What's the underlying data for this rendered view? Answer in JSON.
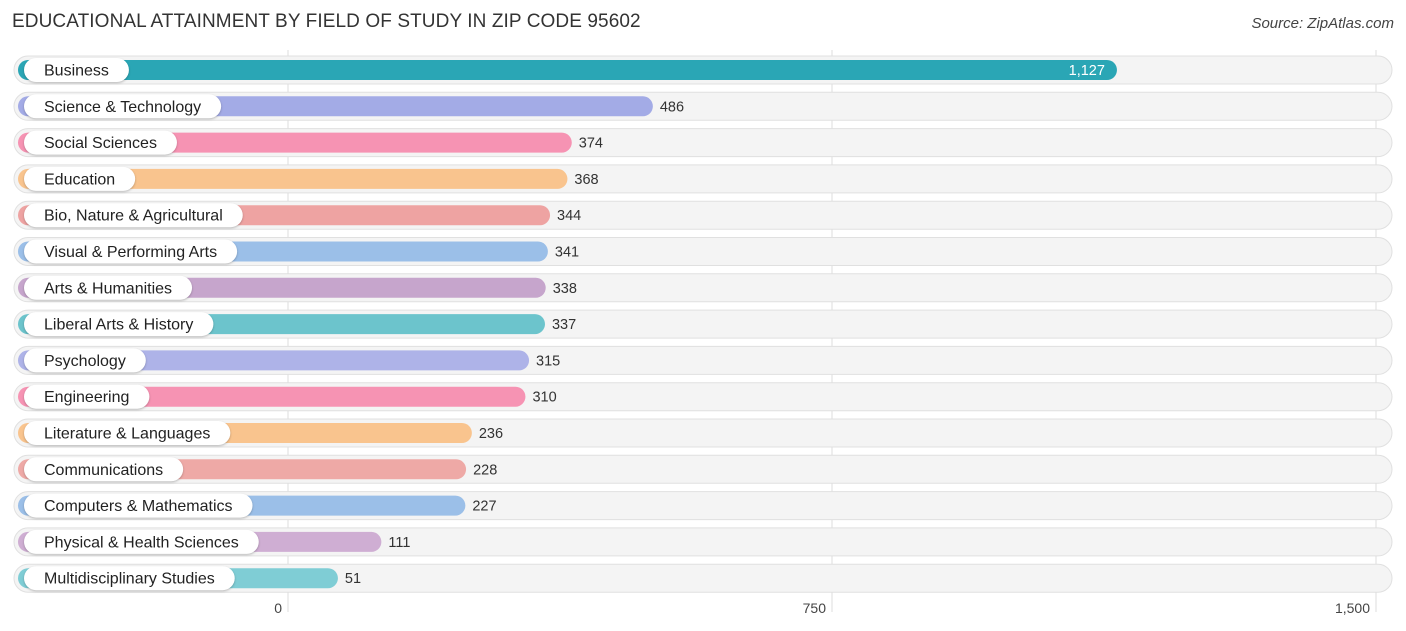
{
  "title": "EDUCATIONAL ATTAINMENT BY FIELD OF STUDY IN ZIP CODE 95602",
  "source": "Source: ZipAtlas.com",
  "chart_data": {
    "type": "bar",
    "orientation": "horizontal",
    "title": "EDUCATIONAL ATTAINMENT BY FIELD OF STUDY IN ZIP CODE 95602",
    "xlabel": "",
    "ylabel": "",
    "xlim": [
      0,
      1500
    ],
    "xticks": [
      0,
      750,
      1500
    ],
    "xtick_labels": [
      "0",
      "750",
      "1,500"
    ],
    "grid": true,
    "categories": [
      "Business",
      "Science & Technology",
      "Social Sciences",
      "Education",
      "Bio, Nature & Agricultural",
      "Visual & Performing Arts",
      "Arts & Humanities",
      "Liberal Arts & History",
      "Psychology",
      "Engineering",
      "Literature & Languages",
      "Communications",
      "Computers & Mathematics",
      "Physical & Health Sciences",
      "Multidisciplinary Studies"
    ],
    "values": [
      1127,
      486,
      374,
      368,
      344,
      341,
      338,
      337,
      315,
      310,
      236,
      228,
      227,
      111,
      51
    ],
    "value_labels": [
      "1,127",
      "486",
      "374",
      "368",
      "344",
      "341",
      "338",
      "337",
      "315",
      "310",
      "236",
      "228",
      "227",
      "111",
      "51"
    ],
    "colors": [
      "#2aa6b5",
      "#a3abe6",
      "#f693b3",
      "#f9c48e",
      "#eea3a2",
      "#9bbfe8",
      "#c6a5cc",
      "#6cc4cc",
      "#aeb3e8",
      "#f693b3",
      "#f9c48e",
      "#eea9a6",
      "#9bbfe8",
      "#cfaed3",
      "#7fcdd5"
    ]
  }
}
